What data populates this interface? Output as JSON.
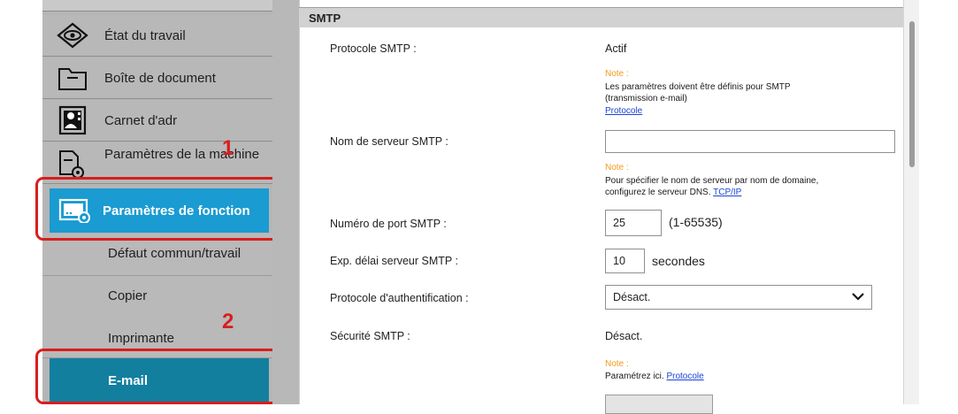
{
  "sidebar": {
    "items": [
      {
        "label": "État du travail",
        "icon": "eye-icon"
      },
      {
        "label": "Boîte de document",
        "icon": "folder-icon"
      },
      {
        "label": "Carnet d'adr",
        "icon": "address-book-icon"
      },
      {
        "label": "Paramètres de la machine",
        "icon": "device-settings-icon"
      }
    ],
    "function_settings": {
      "label": "Paramètres de fonction",
      "icon": "function-settings-icon"
    },
    "sub_items": [
      {
        "label": "Défaut commun/travail"
      },
      {
        "label": "Copier"
      },
      {
        "label": "Imprimante"
      }
    ],
    "email": {
      "label": "E-mail"
    }
  },
  "callouts": {
    "one": "1",
    "two": "2"
  },
  "section": {
    "title": "SMTP"
  },
  "form": {
    "smtp_protocol": {
      "label": "Protocole SMTP :",
      "value": "Actif",
      "note_title": "Note :",
      "note_line1": "Les paramètres doivent être définis pour SMTP",
      "note_line2": "(transmission e-mail)",
      "note_link": "Protocole"
    },
    "server_name": {
      "label": "Nom de serveur SMTP :",
      "value": "",
      "note_title": "Note :",
      "note_line1": "Pour spécifier le nom de serveur par nom de domaine,",
      "note_line2": "configurez le serveur DNS.",
      "note_link": "TCP/IP"
    },
    "port": {
      "label": "Numéro de port SMTP :",
      "value": "25",
      "range": "(1-65535)"
    },
    "timeout": {
      "label": "Exp. délai serveur SMTP :",
      "value": "10",
      "unit": "secondes"
    },
    "auth_protocol": {
      "label": "Protocole d'authentification :",
      "selected": "Désact."
    },
    "security": {
      "label": "Sécurité SMTP :",
      "value": "Désact.",
      "note_title": "Note :",
      "note_text": "Paramétrez ici.",
      "note_link": "Protocole"
    }
  },
  "colors": {
    "accent": "#1a9bd1",
    "email_selected": "#137f9f",
    "callout": "#d81e1e",
    "note": "#f39a1b",
    "link": "#1a44d6"
  }
}
